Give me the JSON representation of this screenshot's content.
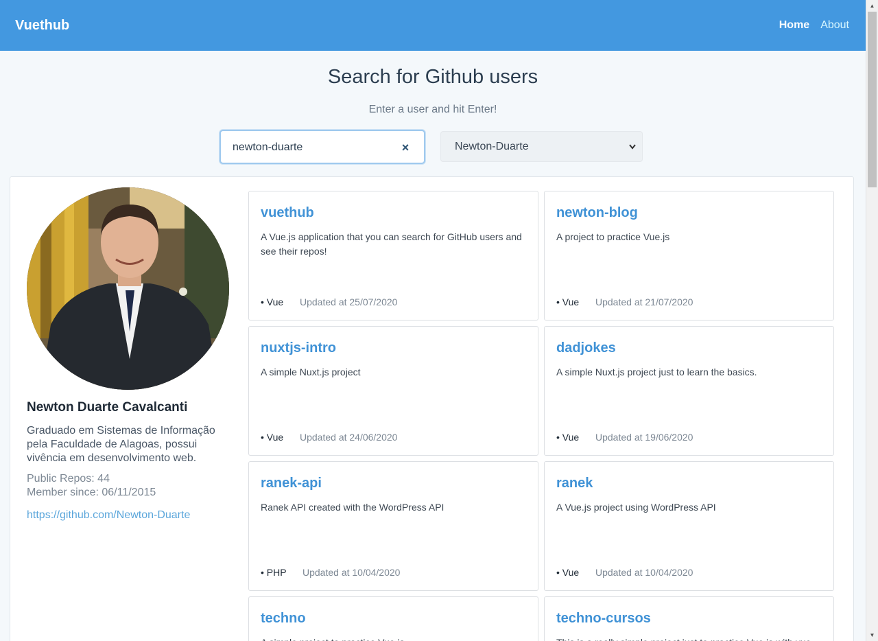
{
  "nav": {
    "brand": "Vuethub",
    "home": "Home",
    "about": "About"
  },
  "search": {
    "title": "Search for Github users",
    "subtitle": "Enter a user and hit Enter!",
    "input_value": "newton-duarte",
    "clear_glyph": "×",
    "selected_user": "Newton-Duarte"
  },
  "profile": {
    "name": "Newton Duarte Cavalcanti",
    "bio": "Graduado em Sistemas de Informação pela Faculdade de Alagoas, possui vivência em desenvolvimento web.",
    "public_repos": "Public Repos: 44",
    "member_since": "Member since: 06/11/2015",
    "github_url": "https://github.com/Newton-Duarte"
  },
  "repos": [
    {
      "name": "vuethub",
      "description": "A Vue.js application that you can search for GitHub users and see their repos!",
      "language": "• Vue",
      "updated": "Updated at 25/07/2020"
    },
    {
      "name": "newton-blog",
      "description": "A project to practice Vue.js",
      "language": "• Vue",
      "updated": "Updated at 21/07/2020"
    },
    {
      "name": "nuxtjs-intro",
      "description": "A simple Nuxt.js project",
      "language": "• Vue",
      "updated": "Updated at 24/06/2020"
    },
    {
      "name": "dadjokes",
      "description": "A simple Nuxt.js project just to learn the basics.",
      "language": "• Vue",
      "updated": "Updated at 19/06/2020"
    },
    {
      "name": "ranek-api",
      "description": "Ranek API created with the WordPress API",
      "language": "• PHP",
      "updated": "Updated at 10/04/2020"
    },
    {
      "name": "ranek",
      "description": "A Vue.js project using WordPress API",
      "language": "• Vue",
      "updated": "Updated at 10/04/2020"
    },
    {
      "name": "techno",
      "description": "A simple project to practice Vue.js",
      "language": "",
      "updated": ""
    },
    {
      "name": "techno-cursos",
      "description": "This is a really simple project just to practice Vue.js with vue",
      "language": "",
      "updated": ""
    }
  ],
  "colors": {
    "navbar": "#4398e0",
    "accent": "#4092d6",
    "link": "#5ba6db"
  },
  "icons": {
    "clear": "close-icon",
    "select": "chevron-down-icon",
    "scroll_up": "arrow-up-icon",
    "scroll_down": "arrow-down-icon"
  }
}
